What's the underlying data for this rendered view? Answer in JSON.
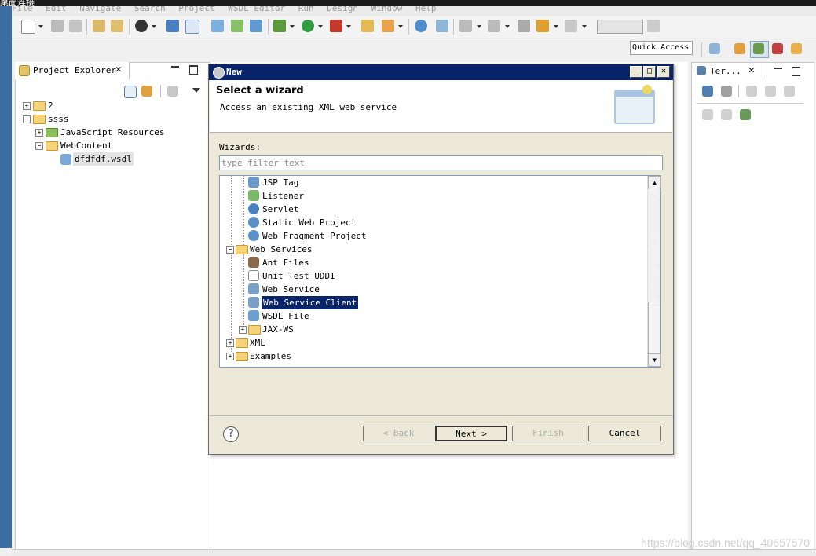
{
  "window": {
    "title_fragment": "桌面连接"
  },
  "menubar": {
    "items": [
      "File",
      "Edit",
      "Navigate",
      "Search",
      "Project",
      "WSDL Editor",
      "Run",
      "Design",
      "Window",
      "Help"
    ]
  },
  "toolbar": {
    "quick_access_label": "Quick Access"
  },
  "project_explorer": {
    "tab_label": "Project Explorer",
    "tree": [
      {
        "label": "2",
        "level": 0,
        "expander": "+"
      },
      {
        "label": "ssss",
        "level": 0,
        "expander": "-"
      },
      {
        "label": "JavaScript Resources",
        "level": 1,
        "expander": "+"
      },
      {
        "label": "WebContent",
        "level": 1,
        "expander": "-"
      },
      {
        "label": "dfdfdf.wsdl",
        "level": 2,
        "expander": ""
      }
    ]
  },
  "right_panel": {
    "tab_label": "Ter..."
  },
  "dialog": {
    "title": "New",
    "heading": "Select a wizard",
    "description": "Access an existing XML web service",
    "wizards_label": "Wizards:",
    "filter_placeholder": "type filter text",
    "tree": [
      {
        "label": "JSP Tag",
        "level": 2,
        "expander": ""
      },
      {
        "label": "Listener",
        "level": 2,
        "expander": ""
      },
      {
        "label": "Servlet",
        "level": 2,
        "expander": ""
      },
      {
        "label": "Static Web Project",
        "level": 2,
        "expander": ""
      },
      {
        "label": "Web Fragment Project",
        "level": 2,
        "expander": ""
      },
      {
        "label": "Web Services",
        "level": 1,
        "expander": "-"
      },
      {
        "label": "Ant Files",
        "level": 2,
        "expander": ""
      },
      {
        "label": "Unit Test UDDI",
        "level": 2,
        "expander": ""
      },
      {
        "label": "Web Service",
        "level": 2,
        "expander": ""
      },
      {
        "label": "Web Service Client",
        "level": 2,
        "expander": "",
        "selected": true
      },
      {
        "label": "WSDL File",
        "level": 2,
        "expander": ""
      },
      {
        "label": "JAX-WS",
        "level": 2,
        "expander": "+"
      },
      {
        "label": "XML",
        "level": 1,
        "expander": "+"
      },
      {
        "label": "Examples",
        "level": 1,
        "expander": "+"
      }
    ],
    "buttons": {
      "back": "< Back",
      "next": "Next >",
      "finish": "Finish",
      "cancel": "Cancel"
    }
  },
  "watermark": "https://blog.csdn.net/qq_40657570",
  "colors": {
    "title_bar": "#0a246a",
    "selection": "#0a246a",
    "folder": "#f4d47a",
    "taskbar": "#3b6ea5"
  }
}
